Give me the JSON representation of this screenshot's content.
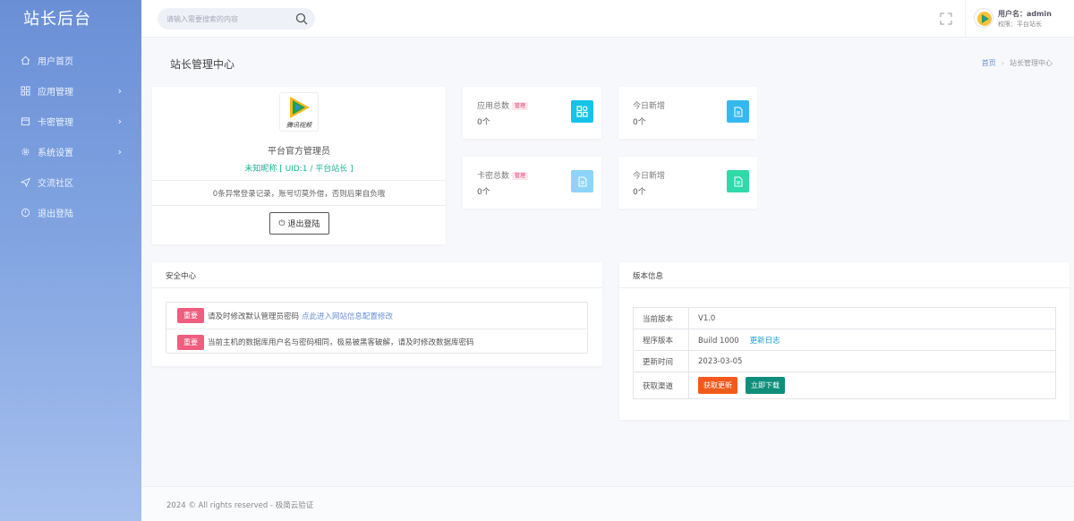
{
  "brand": "站长后台",
  "sidebar": {
    "items": [
      {
        "label": "用户首页",
        "icon": "home-icon",
        "chevron": false
      },
      {
        "label": "应用管理",
        "icon": "apps-icon",
        "chevron": true
      },
      {
        "label": "卡密管理",
        "icon": "calendar-icon",
        "chevron": true
      },
      {
        "label": "系统设置",
        "icon": "gear-icon",
        "chevron": true
      },
      {
        "label": "交流社区",
        "icon": "send-icon",
        "chevron": false
      },
      {
        "label": "退出登陆",
        "icon": "logout-icon",
        "chevron": false
      }
    ]
  },
  "search": {
    "placeholder": "请输入需要搜索的内容"
  },
  "user": {
    "name": "用户名：admin",
    "role": "权限：平台站长"
  },
  "page": {
    "title": "站长管理中心",
    "breadcrumb_home": "首页",
    "breadcrumb_current": "站长管理中心"
  },
  "profile": {
    "logo_text": "腾讯视频",
    "role": "平台官方管理员",
    "nick": "未知昵称 [ UID:1 / 平台站长 ]",
    "login_note": "0条异常登录记录，账号切莫外借，否则后果自负哦",
    "logout_label": "退出登陆"
  },
  "stats": [
    {
      "label": "应用总数",
      "tag": "管理",
      "value": "0个",
      "icon": "grid-icon",
      "color": "#16c3e8"
    },
    {
      "label": "今日新增",
      "tag": "",
      "value": "0个",
      "icon": "document-icon",
      "color": "#35b8f0"
    },
    {
      "label": "卡密总数",
      "tag": "管理",
      "value": "0个",
      "icon": "document-icon",
      "color": "#8dd4f8"
    },
    {
      "label": "今日新增",
      "tag": "",
      "value": "0个",
      "icon": "document-icon",
      "color": "#2fd9a8"
    }
  ],
  "security": {
    "title": "安全中心",
    "rows": [
      {
        "badge": "重要",
        "text": "请及时修改默认管理员密码",
        "link": "点此进入网站信息配置修改"
      },
      {
        "badge": "重要",
        "text": "当前主机的数据库用户名与密码相同，极易被黑客破解，请及时修改数据库密码",
        "link": ""
      }
    ]
  },
  "version": {
    "title": "版本信息",
    "current_label": "当前版本",
    "current_value": "V1.0",
    "build_label": "程序版本",
    "build_value": "Build 1000",
    "changelog": "更新日志",
    "date_label": "更新时间",
    "date_value": "2023-03-05",
    "channel_label": "获取渠道",
    "update_btn": "获取更新",
    "download_btn": "立即下载"
  },
  "footer": "2024 © All rights reserved - 极简云验证"
}
